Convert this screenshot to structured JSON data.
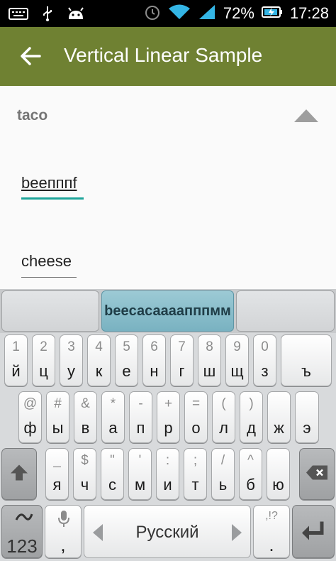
{
  "status_bar": {
    "battery": "72%",
    "time": "17:28",
    "icons": [
      "keyboard-icon",
      "usb-icon",
      "android-icon",
      "alarm-icon",
      "wifi-icon",
      "signal-icon",
      "battery-charging-icon"
    ]
  },
  "app_bar": {
    "title": "Vertical Linear Sample",
    "back_icon": "back-arrow-icon"
  },
  "content": {
    "section_title": "taco",
    "collapse_icon": "collapse-arrow-icon",
    "field1_value": "beeпппf",
    "field2_value": "cheese"
  },
  "keyboard": {
    "suggestions": [
      "",
      "beeсасаааапппмм",
      ""
    ],
    "row1": [
      {
        "top": "1",
        "main": "й"
      },
      {
        "top": "2",
        "main": "ц"
      },
      {
        "top": "3",
        "main": "у"
      },
      {
        "top": "4",
        "main": "к"
      },
      {
        "top": "5",
        "main": "е"
      },
      {
        "top": "6",
        "main": "н"
      },
      {
        "top": "7",
        "main": "г"
      },
      {
        "top": "8",
        "main": "ш"
      },
      {
        "top": "9",
        "main": "щ"
      },
      {
        "top": "0",
        "main": "з"
      },
      {
        "top": "",
        "main": "ъ"
      }
    ],
    "row2": [
      {
        "top": "@",
        "main": "ф"
      },
      {
        "top": "#",
        "main": "ы"
      },
      {
        "top": "&",
        "main": "в"
      },
      {
        "top": "*",
        "main": "а"
      },
      {
        "top": "-",
        "main": "п"
      },
      {
        "top": "+",
        "main": "р"
      },
      {
        "top": "=",
        "main": "о"
      },
      {
        "top": "(",
        "main": "л"
      },
      {
        "top": ")",
        "main": "д"
      },
      {
        "top": "",
        "main": "ж"
      },
      {
        "top": "",
        "main": "э"
      }
    ],
    "row3": [
      {
        "top": "_",
        "main": "я"
      },
      {
        "top": "$",
        "main": "ч"
      },
      {
        "top": "\"",
        "main": "с"
      },
      {
        "top": "'",
        "main": "м"
      },
      {
        "top": ":",
        "main": "и"
      },
      {
        "top": ";",
        "main": "т"
      },
      {
        "top": "/",
        "main": "ь"
      },
      {
        "top": "^",
        "main": "б"
      },
      {
        "top": "",
        "main": "ю"
      }
    ],
    "symbols_key": "123",
    "comma_key": ",",
    "space_label": "Русский",
    "period_top": ",!?",
    "period_key": "."
  }
}
